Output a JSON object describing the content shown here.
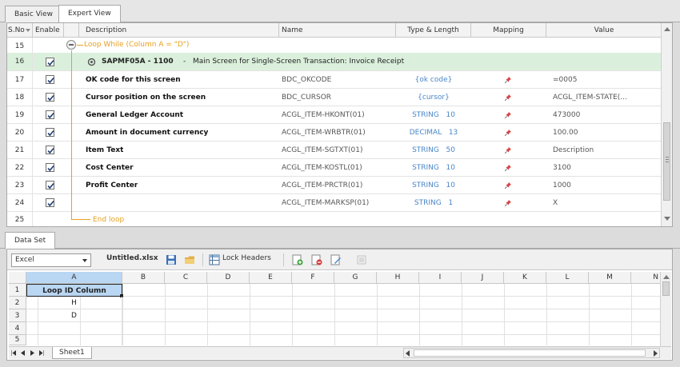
{
  "tabs": [
    {
      "label": "Basic View",
      "active": false
    },
    {
      "label": "Expert View",
      "active": true
    }
  ],
  "grid": {
    "headers": {
      "sno": "S.No",
      "enable": "Enable",
      "description": "Description",
      "name": "Name",
      "type_length": "Type & Length",
      "mapping": "Mapping",
      "value": "Value"
    },
    "loop_start": {
      "sno": "15",
      "label": "Loop While (Column A = \"D\")"
    },
    "screen_row": {
      "sno": "16",
      "program": "SAPMF05A - 1100",
      "separator": "-",
      "title": "Main Screen for Single-Screen Transaction: Invoice Receipt"
    },
    "rows": [
      {
        "sno": "17",
        "desc": "OK code for this screen",
        "name": "BDC_OKCODE",
        "type": "{ok code}",
        "len": "",
        "value": "=0005"
      },
      {
        "sno": "18",
        "desc": "Cursor position on the screen",
        "name": "BDC_CURSOR",
        "type": "{cursor}",
        "len": "",
        "value": "ACGL_ITEM-STATE(..."
      },
      {
        "sno": "19",
        "desc": "General Ledger Account",
        "name": "ACGL_ITEM-HKONT(01)",
        "type": "STRING",
        "len": "10",
        "value": "473000"
      },
      {
        "sno": "20",
        "desc": "Amount in document currency",
        "name": "ACGL_ITEM-WRBTR(01)",
        "type": "DECIMAL",
        "len": "13",
        "value": "100.00"
      },
      {
        "sno": "21",
        "desc": "Item Text",
        "name": "ACGL_ITEM-SGTXT(01)",
        "type": "STRING",
        "len": "50",
        "value": "Description"
      },
      {
        "sno": "22",
        "desc": "Cost Center",
        "name": "ACGL_ITEM-KOSTL(01)",
        "type": "STRING",
        "len": "10",
        "value": "3100"
      },
      {
        "sno": "23",
        "desc": "Profit Center",
        "name": "ACGL_ITEM-PRCTR(01)",
        "type": "STRING",
        "len": "10",
        "value": "1000"
      },
      {
        "sno": "24",
        "desc": "",
        "name": "ACGL_ITEM-MARKSP(01)",
        "type": "STRING",
        "len": "1",
        "value": "X"
      }
    ],
    "loop_end": {
      "sno": "25",
      "label": "End loop"
    }
  },
  "dataset": {
    "tab_label": "Data Set",
    "source": "Excel",
    "filename": "Untitled.xlsx",
    "lock_headers": "Lock Headers",
    "columns": [
      "A",
      "B",
      "C",
      "D",
      "E",
      "F",
      "G",
      "H",
      "I",
      "J",
      "K",
      "L",
      "M",
      "N"
    ],
    "rows": [
      "1",
      "2",
      "3",
      "4",
      "5"
    ],
    "cells": {
      "A1": "Loop ID Column",
      "A2": "H",
      "A3": "D"
    },
    "sheet_name": "Sheet1"
  },
  "colors": {
    "loop": "#e8a020",
    "screen_row": "#dbf0dc",
    "type_text": "#4a86c8",
    "header_cell": "#b9d6f2"
  }
}
